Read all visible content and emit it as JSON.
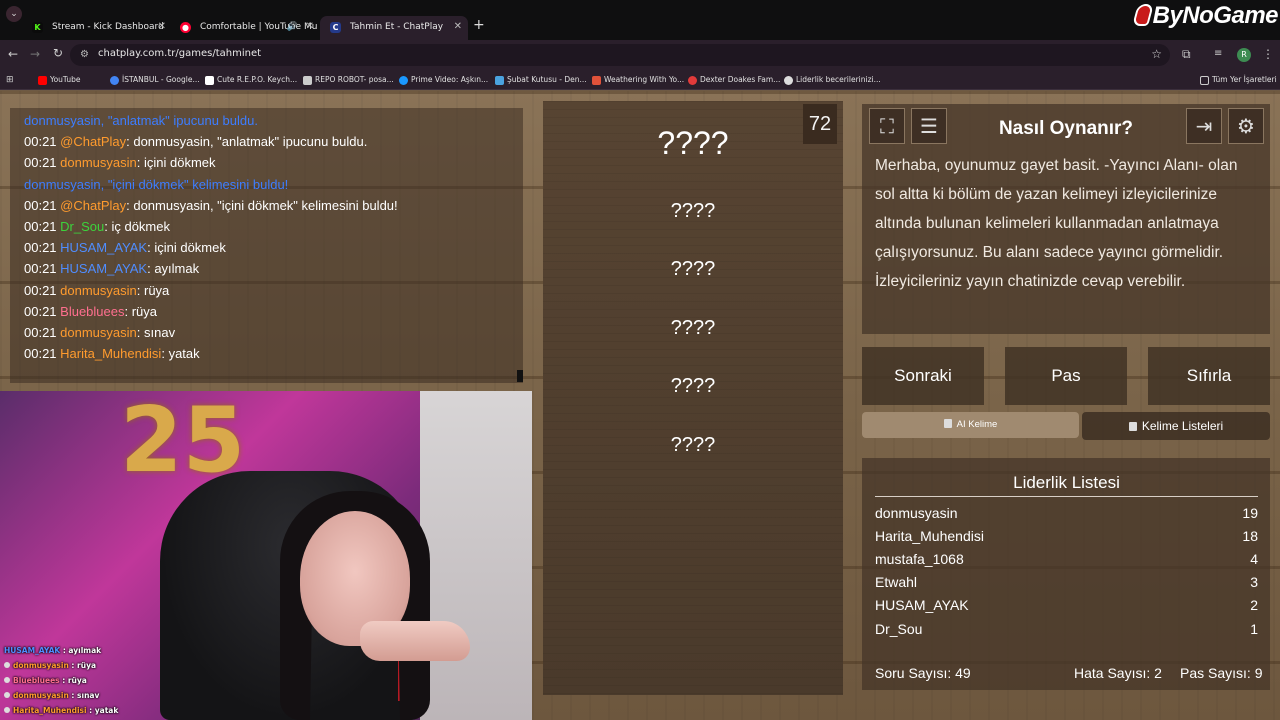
{
  "browser": {
    "tabs": [
      {
        "title": "Stream - Kick Dashboard",
        "icon": "kick-icon",
        "color": "#53fc18"
      },
      {
        "title": "Comfortable | YouTube Mu",
        "icon": "youtube-music-icon",
        "color": "#ff0033"
      },
      {
        "title": "Tahmin Et - ChatPlay",
        "icon": "chatplay-icon",
        "color": "#3355cc"
      }
    ],
    "new_tab": "+",
    "url": "chatplay.com.tr/games/tahminet",
    "bookmarks": [
      {
        "label": "YouTube",
        "color": "#ff0000"
      },
      {
        "label": "İSTANBUL - Google...",
        "color": "#4285f4"
      },
      {
        "label": "Cute R.E.P.O. Keych...",
        "color": "#ffffff"
      },
      {
        "label": "REPO ROBOT- posa...",
        "color": "#cccccc"
      },
      {
        "label": "Prime Video: Aşkın...",
        "color": "#1a98ff"
      },
      {
        "label": "Şubat Kutusu - Den...",
        "color": "#4aa3df"
      },
      {
        "label": "Weathering With Yo...",
        "color": "#e0523a"
      },
      {
        "label": "Dexter Doakes Fam...",
        "color": "#e23a3a"
      },
      {
        "label": "Liderlik becerilerinizi...",
        "color": "#dddddd"
      }
    ],
    "all_bookmarks": "Tüm Yer İşaretleri",
    "profile_initial": "R"
  },
  "brand": "ByNoGame",
  "chat": {
    "lines": [
      {
        "time": "",
        "user": "donmusyasin, \"anlatmak\" ipucunu buldu.",
        "user_class": "u-blue",
        "sep": "",
        "msg": ""
      },
      {
        "time": "00:21 ",
        "user": "@ChatPlay",
        "user_class": "u-orange",
        "sep": ": ",
        "msg": "donmusyasin, \"anlatmak\" ipucunu buldu."
      },
      {
        "time": "00:21 ",
        "user": "donmusyasin",
        "user_class": "u-orange",
        "sep": ": ",
        "msg": "içini dökmek"
      },
      {
        "time": "",
        "user": "donmusyasin, \"içini dökmek\" kelimesini buldu!",
        "user_class": "u-blue",
        "sep": "",
        "msg": ""
      },
      {
        "time": "00:21 ",
        "user": "@ChatPlay",
        "user_class": "u-orange",
        "sep": ": ",
        "msg": "donmusyasin, \"içini dökmek\" kelimesini buldu!"
      },
      {
        "time": "00:21 ",
        "user": "Dr_Sou",
        "user_class": "u-green",
        "sep": ": ",
        "msg": "iç dökmek"
      },
      {
        "time": "00:21 ",
        "user": "HUSAM_AYAK",
        "user_class": "u-lblue",
        "sep": ": ",
        "msg": "içini dökmek"
      },
      {
        "time": "00:21 ",
        "user": "HUSAM_AYAK",
        "user_class": "u-lblue",
        "sep": ": ",
        "msg": "ayılmak"
      },
      {
        "time": "00:21 ",
        "user": "donmusyasin",
        "user_class": "u-orange",
        "sep": ": ",
        "msg": "rüya"
      },
      {
        "time": "00:21 ",
        "user": "Bluebluees",
        "user_class": "u-pink",
        "sep": ": ",
        "msg": "rüya"
      },
      {
        "time": "00:21 ",
        "user": "donmusyasin",
        "user_class": "u-orange",
        "sep": ": ",
        "msg": "sınav"
      },
      {
        "time": "00:21 ",
        "user": "Harita_Muhendisi",
        "user_class": "u-orange",
        "sep": ": ",
        "msg": "yatak"
      }
    ]
  },
  "webcam": {
    "overlay_chat": [
      {
        "user": "HUSAM_AYAK",
        "msg": " : ayılmak",
        "color": "#4f8dff"
      },
      {
        "user": "donmusyasin",
        "msg": " : rüya",
        "color": "#ff9b2e"
      },
      {
        "user": "Bluebluees",
        "msg": " : rüya",
        "color": "#ff6f8f"
      },
      {
        "user": "donmusyasin",
        "msg": " : sınav",
        "color": "#ff9b2e"
      },
      {
        "user": "Harita_Muhendisi",
        "msg": " : yatak",
        "color": "#ff9b2e"
      }
    ]
  },
  "game": {
    "timer": "72",
    "main_word": "????",
    "hint_words": [
      "????",
      "????",
      "????",
      "????",
      "????"
    ]
  },
  "howto": {
    "title": "Nasıl Oynanır?",
    "text": "Merhaba, oyunumuz gayet basit. -Yayıncı Alanı- olan sol altta ki bölüm de yazan kelimeyi izleyicilerinize altında bulunan kelimeleri kullanmadan anlatmaya çalışıyorsunuz. Bu alanı sadece yayıncı görmelidir. İzleyicileriniz yayın chatinizde cevap verebilir."
  },
  "actions": {
    "next": "Sonraki",
    "pass": "Pas",
    "reset": "Sıfırla"
  },
  "tabs": {
    "ai_word": "AI Kelime",
    "word_lists": "Kelime Listeleri"
  },
  "leaderboard": {
    "title": "Liderlik Listesi",
    "rows": [
      {
        "name": "donmusyasin",
        "score": "19"
      },
      {
        "name": "Harita_Muhendisi",
        "score": "18"
      },
      {
        "name": "mustafa_1068",
        "score": "4"
      },
      {
        "name": "Etwahl",
        "score": "3"
      },
      {
        "name": "HUSAM_AYAK",
        "score": "2"
      },
      {
        "name": "Dr_Sou",
        "score": "1"
      }
    ]
  },
  "stats": {
    "questions": "Soru Sayısı: 49",
    "errors": "Hata Sayısı: 2",
    "passes": "Pas Sayısı: 9"
  }
}
